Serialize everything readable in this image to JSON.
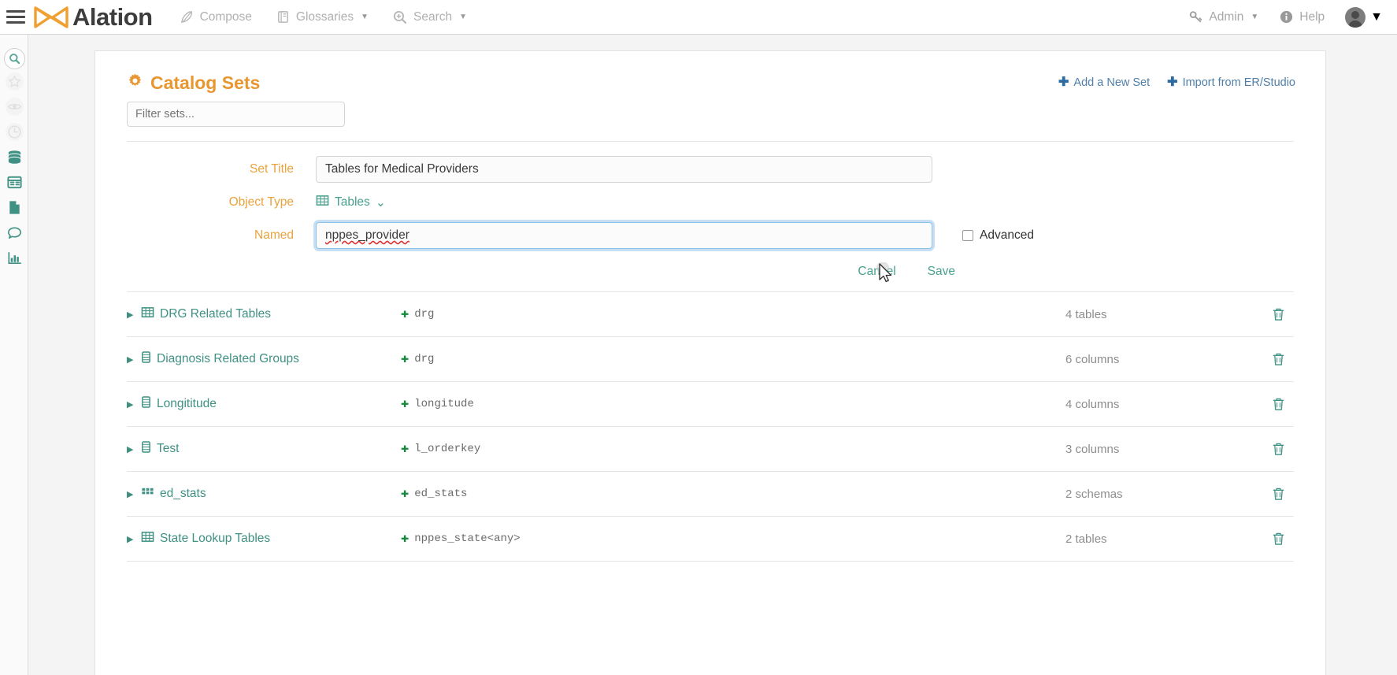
{
  "topnav": {
    "menu_icon": "hamburger-icon",
    "brand": "Alation",
    "items": [
      {
        "label": "Compose",
        "icon": "feather-icon",
        "caret": false
      },
      {
        "label": "Glossaries",
        "icon": "book-icon",
        "caret": true
      },
      {
        "label": "Search",
        "icon": "search-plus-icon",
        "caret": true
      }
    ],
    "right_items": [
      {
        "label": "Admin",
        "icon": "key-icon",
        "caret": true
      },
      {
        "label": "Help",
        "icon": "info-icon",
        "caret": false
      }
    ],
    "avatar": "user-avatar"
  },
  "rail": {
    "items": [
      {
        "icon": "search-icon",
        "active": true
      },
      {
        "icon": "star-icon",
        "active": false
      },
      {
        "icon": "eye-icon",
        "active": false
      },
      {
        "icon": "clock-icon",
        "active": false
      },
      {
        "icon": "database-icon",
        "active": false
      },
      {
        "icon": "table-icon",
        "active": false
      },
      {
        "icon": "document-icon",
        "active": false
      },
      {
        "icon": "chat-icon",
        "active": false
      },
      {
        "icon": "bar-chart-icon",
        "active": false
      }
    ]
  },
  "card": {
    "title": "Catalog Sets",
    "title_icon": "gear-icon",
    "add_new_set": "Add a New Set",
    "import_er_studio": "Import from ER/Studio",
    "filter_placeholder": "Filter sets..."
  },
  "form": {
    "set_title_label": "Set Title",
    "set_title_value": "Tables for Medical Providers",
    "object_type_label": "Object Type",
    "object_type_value": "Tables",
    "object_type_icon": "table-grid-icon",
    "named_label": "Named",
    "named_value": "nppes_provider",
    "advanced_label": "Advanced",
    "advanced_checked": false,
    "cancel_label": "Cancel",
    "save_label": "Save"
  },
  "colors": {
    "accent_orange": "#e8962f",
    "teal": "#3f9184",
    "link_blue": "#4f7fa8",
    "plus_green": "#12893b"
  },
  "sets": [
    {
      "name": "DRG Related Tables",
      "icon": "table-grid-icon",
      "query": "drg",
      "count": "4 tables"
    },
    {
      "name": "Diagnosis Related Groups",
      "icon": "column-icon",
      "query": "drg",
      "count": "6 columns"
    },
    {
      "name": "Longititude",
      "icon": "column-icon",
      "query": "longitude",
      "count": "4 columns"
    },
    {
      "name": "Test",
      "icon": "column-icon",
      "query": "l_orderkey",
      "count": "3 columns"
    },
    {
      "name": "ed_stats",
      "icon": "schema-icon",
      "query": "ed_stats",
      "count": "2 schemas"
    },
    {
      "name": "State Lookup Tables",
      "icon": "table-grid-icon",
      "query": "nppes_state<any>",
      "count": "2 tables"
    }
  ],
  "icons": {
    "expand_arrow": "▶",
    "trash": "trash-icon",
    "plus": "+"
  }
}
